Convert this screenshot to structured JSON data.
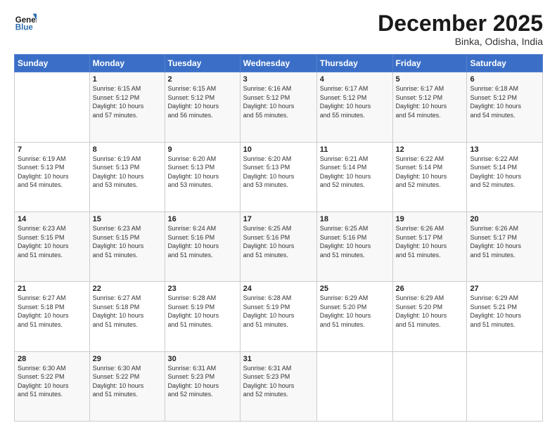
{
  "logo": {
    "line1": "General",
    "line2": "Blue"
  },
  "title": "December 2025",
  "subtitle": "Binka, Odisha, India",
  "header_days": [
    "Sunday",
    "Monday",
    "Tuesday",
    "Wednesday",
    "Thursday",
    "Friday",
    "Saturday"
  ],
  "weeks": [
    [
      {
        "day": "",
        "info": ""
      },
      {
        "day": "1",
        "info": "Sunrise: 6:15 AM\nSunset: 5:12 PM\nDaylight: 10 hours\nand 57 minutes."
      },
      {
        "day": "2",
        "info": "Sunrise: 6:15 AM\nSunset: 5:12 PM\nDaylight: 10 hours\nand 56 minutes."
      },
      {
        "day": "3",
        "info": "Sunrise: 6:16 AM\nSunset: 5:12 PM\nDaylight: 10 hours\nand 55 minutes."
      },
      {
        "day": "4",
        "info": "Sunrise: 6:17 AM\nSunset: 5:12 PM\nDaylight: 10 hours\nand 55 minutes."
      },
      {
        "day": "5",
        "info": "Sunrise: 6:17 AM\nSunset: 5:12 PM\nDaylight: 10 hours\nand 54 minutes."
      },
      {
        "day": "6",
        "info": "Sunrise: 6:18 AM\nSunset: 5:12 PM\nDaylight: 10 hours\nand 54 minutes."
      }
    ],
    [
      {
        "day": "7",
        "info": "Sunrise: 6:19 AM\nSunset: 5:13 PM\nDaylight: 10 hours\nand 54 minutes."
      },
      {
        "day": "8",
        "info": "Sunrise: 6:19 AM\nSunset: 5:13 PM\nDaylight: 10 hours\nand 53 minutes."
      },
      {
        "day": "9",
        "info": "Sunrise: 6:20 AM\nSunset: 5:13 PM\nDaylight: 10 hours\nand 53 minutes."
      },
      {
        "day": "10",
        "info": "Sunrise: 6:20 AM\nSunset: 5:13 PM\nDaylight: 10 hours\nand 53 minutes."
      },
      {
        "day": "11",
        "info": "Sunrise: 6:21 AM\nSunset: 5:14 PM\nDaylight: 10 hours\nand 52 minutes."
      },
      {
        "day": "12",
        "info": "Sunrise: 6:22 AM\nSunset: 5:14 PM\nDaylight: 10 hours\nand 52 minutes."
      },
      {
        "day": "13",
        "info": "Sunrise: 6:22 AM\nSunset: 5:14 PM\nDaylight: 10 hours\nand 52 minutes."
      }
    ],
    [
      {
        "day": "14",
        "info": "Sunrise: 6:23 AM\nSunset: 5:15 PM\nDaylight: 10 hours\nand 51 minutes."
      },
      {
        "day": "15",
        "info": "Sunrise: 6:23 AM\nSunset: 5:15 PM\nDaylight: 10 hours\nand 51 minutes."
      },
      {
        "day": "16",
        "info": "Sunrise: 6:24 AM\nSunset: 5:16 PM\nDaylight: 10 hours\nand 51 minutes."
      },
      {
        "day": "17",
        "info": "Sunrise: 6:25 AM\nSunset: 5:16 PM\nDaylight: 10 hours\nand 51 minutes."
      },
      {
        "day": "18",
        "info": "Sunrise: 6:25 AM\nSunset: 5:16 PM\nDaylight: 10 hours\nand 51 minutes."
      },
      {
        "day": "19",
        "info": "Sunrise: 6:26 AM\nSunset: 5:17 PM\nDaylight: 10 hours\nand 51 minutes."
      },
      {
        "day": "20",
        "info": "Sunrise: 6:26 AM\nSunset: 5:17 PM\nDaylight: 10 hours\nand 51 minutes."
      }
    ],
    [
      {
        "day": "21",
        "info": "Sunrise: 6:27 AM\nSunset: 5:18 PM\nDaylight: 10 hours\nand 51 minutes."
      },
      {
        "day": "22",
        "info": "Sunrise: 6:27 AM\nSunset: 5:18 PM\nDaylight: 10 hours\nand 51 minutes."
      },
      {
        "day": "23",
        "info": "Sunrise: 6:28 AM\nSunset: 5:19 PM\nDaylight: 10 hours\nand 51 minutes."
      },
      {
        "day": "24",
        "info": "Sunrise: 6:28 AM\nSunset: 5:19 PM\nDaylight: 10 hours\nand 51 minutes."
      },
      {
        "day": "25",
        "info": "Sunrise: 6:29 AM\nSunset: 5:20 PM\nDaylight: 10 hours\nand 51 minutes."
      },
      {
        "day": "26",
        "info": "Sunrise: 6:29 AM\nSunset: 5:20 PM\nDaylight: 10 hours\nand 51 minutes."
      },
      {
        "day": "27",
        "info": "Sunrise: 6:29 AM\nSunset: 5:21 PM\nDaylight: 10 hours\nand 51 minutes."
      }
    ],
    [
      {
        "day": "28",
        "info": "Sunrise: 6:30 AM\nSunset: 5:22 PM\nDaylight: 10 hours\nand 51 minutes."
      },
      {
        "day": "29",
        "info": "Sunrise: 6:30 AM\nSunset: 5:22 PM\nDaylight: 10 hours\nand 51 minutes."
      },
      {
        "day": "30",
        "info": "Sunrise: 6:31 AM\nSunset: 5:23 PM\nDaylight: 10 hours\nand 52 minutes."
      },
      {
        "day": "31",
        "info": "Sunrise: 6:31 AM\nSunset: 5:23 PM\nDaylight: 10 hours\nand 52 minutes."
      },
      {
        "day": "",
        "info": ""
      },
      {
        "day": "",
        "info": ""
      },
      {
        "day": "",
        "info": ""
      }
    ]
  ]
}
